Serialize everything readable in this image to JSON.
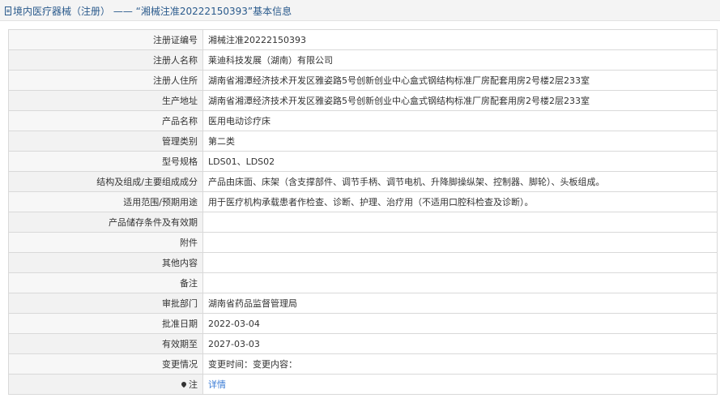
{
  "header": {
    "breadcrumb_category": "境内医疗器械（注册）",
    "separator": "——",
    "record_title": "“湘械注准20222150393”基本信息"
  },
  "fields": [
    {
      "label": "注册证编号",
      "value": "湘械注准20222150393"
    },
    {
      "label": "注册人名称",
      "value": "莱迪科技发展（湖南）有限公司"
    },
    {
      "label": "注册人住所",
      "value": "湖南省湘潭经济技术开发区雅姿路5号创新创业中心盒式钢结构标准厂房配套用房2号楼2层233室"
    },
    {
      "label": "生产地址",
      "value": "湖南省湘潭经济技术开发区雅姿路5号创新创业中心盒式钢结构标准厂房配套用房2号楼2层233室"
    },
    {
      "label": "产品名称",
      "value": "医用电动诊疗床"
    },
    {
      "label": "管理类别",
      "value": "第二类"
    },
    {
      "label": "型号规格",
      "value": "LDS01、LDS02"
    },
    {
      "label": "结构及组成/主要组成成分",
      "value": "产品由床面、床架（含支撑部件、调节手柄、调节电机、升降脚操纵架、控制器、脚轮）、头板组成。"
    },
    {
      "label": "适用范围/预期用途",
      "value": "用于医疗机构承载患者作检查、诊断、护理、治疗用（不适用口腔科检查及诊断）。"
    },
    {
      "label": "产品储存条件及有效期",
      "value": ""
    },
    {
      "label": "附件",
      "value": ""
    },
    {
      "label": "其他内容",
      "value": ""
    },
    {
      "label": "备注",
      "value": ""
    },
    {
      "label": "审批部门",
      "value": "湖南省药品监督管理局"
    },
    {
      "label": "批准日期",
      "value": "2022-03-04"
    },
    {
      "label": "有效期至",
      "value": "2027-03-03"
    },
    {
      "label": "变更情况",
      "value": "变更时间：变更内容："
    }
  ],
  "note": {
    "label": "注",
    "link_text": "详情"
  }
}
